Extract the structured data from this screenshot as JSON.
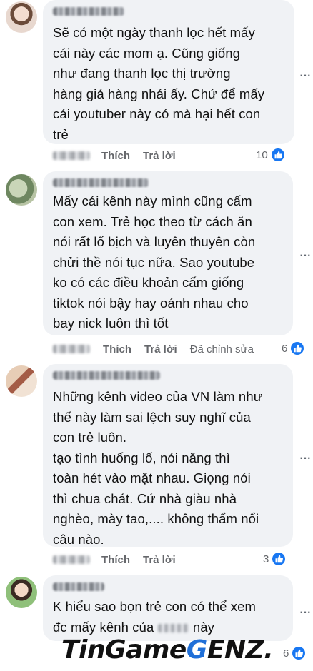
{
  "comments": [
    {
      "text": "Sẽ có một ngày thanh lọc hết mấy\ncái này các mom ạ. Cũng giống\nnhư đang thanh lọc thị trường\nhàng giả hàng nhái ấy. Chứ để mấy\ncái youtuber này có mà hại hết con\ntrẻ",
      "like_label": "Thích",
      "reply_label": "Trả lời",
      "reaction_count": "10",
      "avatar_color": "#d9c6b8"
    },
    {
      "text": "Mấy cái kênh này mình cũng cấm\ncon xem. Trẻ học theo từ cách ăn\nnói rất lố bịch và luyên thuyên còn\nchửi thề nói tục nữa. Sao youtube\nko có các điều khoản cấm giống\ntiktok nói bậy hay oánh nhau cho\nbay nick luôn thì tốt",
      "like_label": "Thích",
      "reply_label": "Trả lời",
      "edited_label": "Đã chỉnh sửa",
      "reaction_count": "6",
      "avatar_color": "#9fb08a"
    },
    {
      "text": "Những kênh video của VN làm như\nthế này làm sai lệch suy nghĩ của\ncon trẻ luôn.\ntạo tình huống lố, nói năng thì\ntoàn hét vào mặt nhau. Giọng nói\nthì chua chát. Cứ nhà giàu nhà\nnghèo, mày tao,.... không thẩm nổi\ncâu nào.",
      "like_label": "Thích",
      "reply_label": "Trả lời",
      "reaction_count": "3",
      "avatar_color": "#c7a98f"
    },
    {
      "text_line1": "K hiểu sao bọn trẻ con có thể xem",
      "text_line2_prefix": "đc mấy kênh của",
      "text_line2_suffix": "này",
      "reaction_count": "6",
      "avatar_color": "#7fae6a"
    }
  ],
  "watermark": {
    "part1": "TinGame",
    "part2": "G",
    "part3": "ENZ."
  },
  "colors": {
    "bubble": "#f0f2f5",
    "like_blue": "#1877f2",
    "meta_gray": "#65676b"
  }
}
